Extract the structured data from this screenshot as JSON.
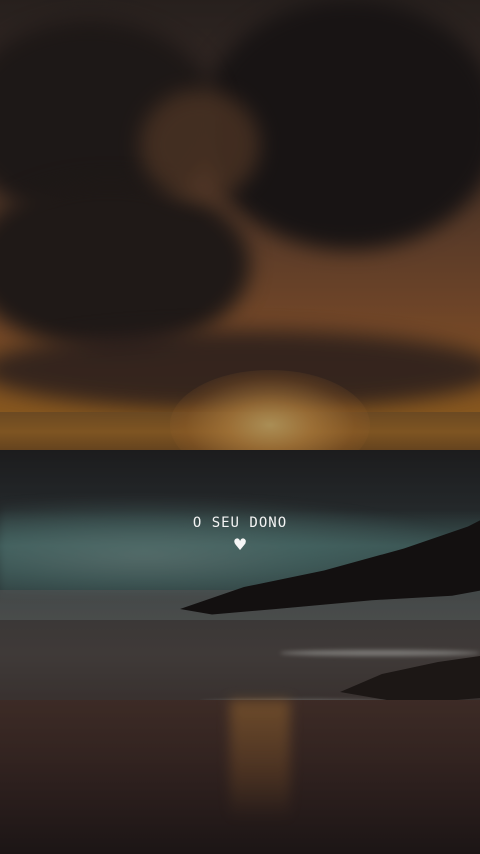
{
  "caption": {
    "text": "O SEU DONO",
    "heart_glyph": "♥",
    "color": "#f4f4f4"
  },
  "scene": {
    "description_colors": {
      "sky_top": "#3a302c",
      "sun": "#ffd682",
      "sea": "#34393c",
      "beach": "#4a3430"
    }
  }
}
